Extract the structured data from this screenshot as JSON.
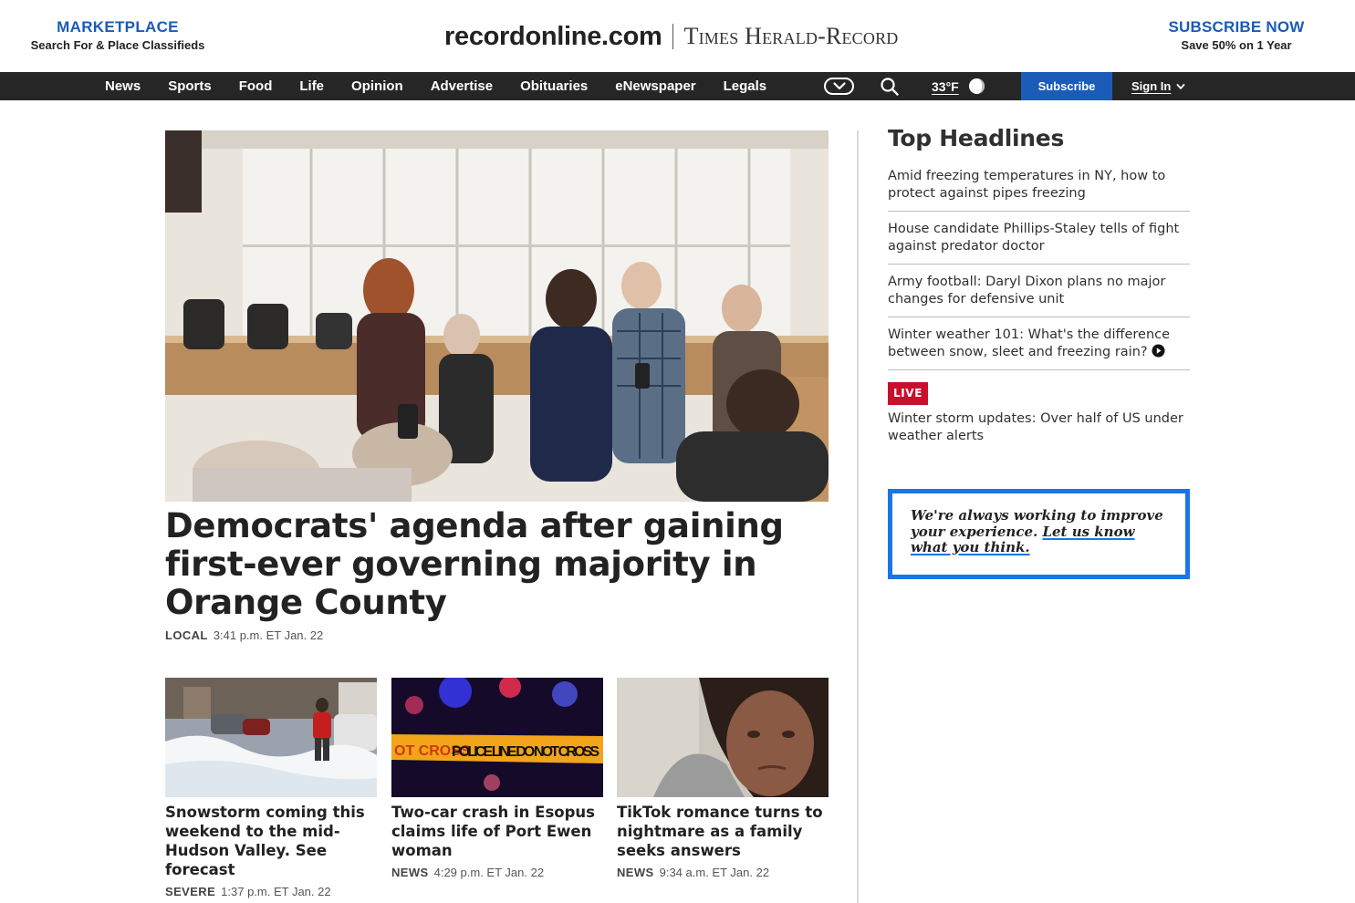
{
  "masthead": {
    "marketplace_title": "MARKETPLACE",
    "marketplace_sub": "Search For & Place Classifieds",
    "site_name": "recordonline.com",
    "paper_name": "Times Herald-Record",
    "subscribe_title": "SUBSCRIBE NOW",
    "subscribe_sub": "Save 50% on 1 Year"
  },
  "nav": {
    "items": [
      "News",
      "Sports",
      "Food",
      "Life",
      "Opinion",
      "Advertise",
      "Obituaries",
      "eNewspaper",
      "Legals"
    ],
    "temperature": "33°F",
    "subscribe_label": "Subscribe",
    "signin_label": "Sign In"
  },
  "lead": {
    "headline": "Democrats' agenda after gaining first-ever governing majority in Orange County",
    "tag": "LOCAL",
    "time": "3:41 p.m. ET Jan. 22"
  },
  "cards": [
    {
      "title": "Snowstorm coming this weekend to the mid-Hudson Valley. See forecast",
      "tag": "SEVERE",
      "time": "1:37 p.m. ET Jan. 22"
    },
    {
      "title": "Two-car crash in Esopus claims life of Port Ewen woman",
      "tag": "NEWS",
      "time": "4:29 p.m. ET Jan. 22",
      "tape_text": "POLICE LINE DO NOT CROSS",
      "tape_text_left": "OT CROSS"
    },
    {
      "title": "TikTok romance turns to nightmare as a family seeks answers",
      "tag": "NEWS",
      "time": "9:34 a.m. ET Jan. 22"
    }
  ],
  "sidebar": {
    "title": "Top Headlines",
    "headlines": [
      "Amid freezing temperatures in NY, how to protect against pipes freezing",
      "House candidate Phillips-Staley tells of fight against predator doctor",
      "Army football: Daryl Dixon plans no major changes for defensive unit",
      "Winter weather 101: What's the difference between snow, sleet and freezing rain?"
    ],
    "live_label": "LIVE",
    "live_headline": "Winter storm updates: Over half of US under weather alerts",
    "feedback_text": "We're always working to improve your experience.",
    "feedback_link": "Let us know what you think."
  },
  "colors": {
    "brand_blue": "#1a5cb8",
    "nav_bg": "#262626",
    "live_red": "#c8102e",
    "feedback_border": "#1b75e6"
  },
  "icons": {
    "nav_more": "chevron-down-icon",
    "search": "search-icon",
    "weather": "moon-icon",
    "signin": "chevron-down-icon",
    "video": "play-icon"
  }
}
